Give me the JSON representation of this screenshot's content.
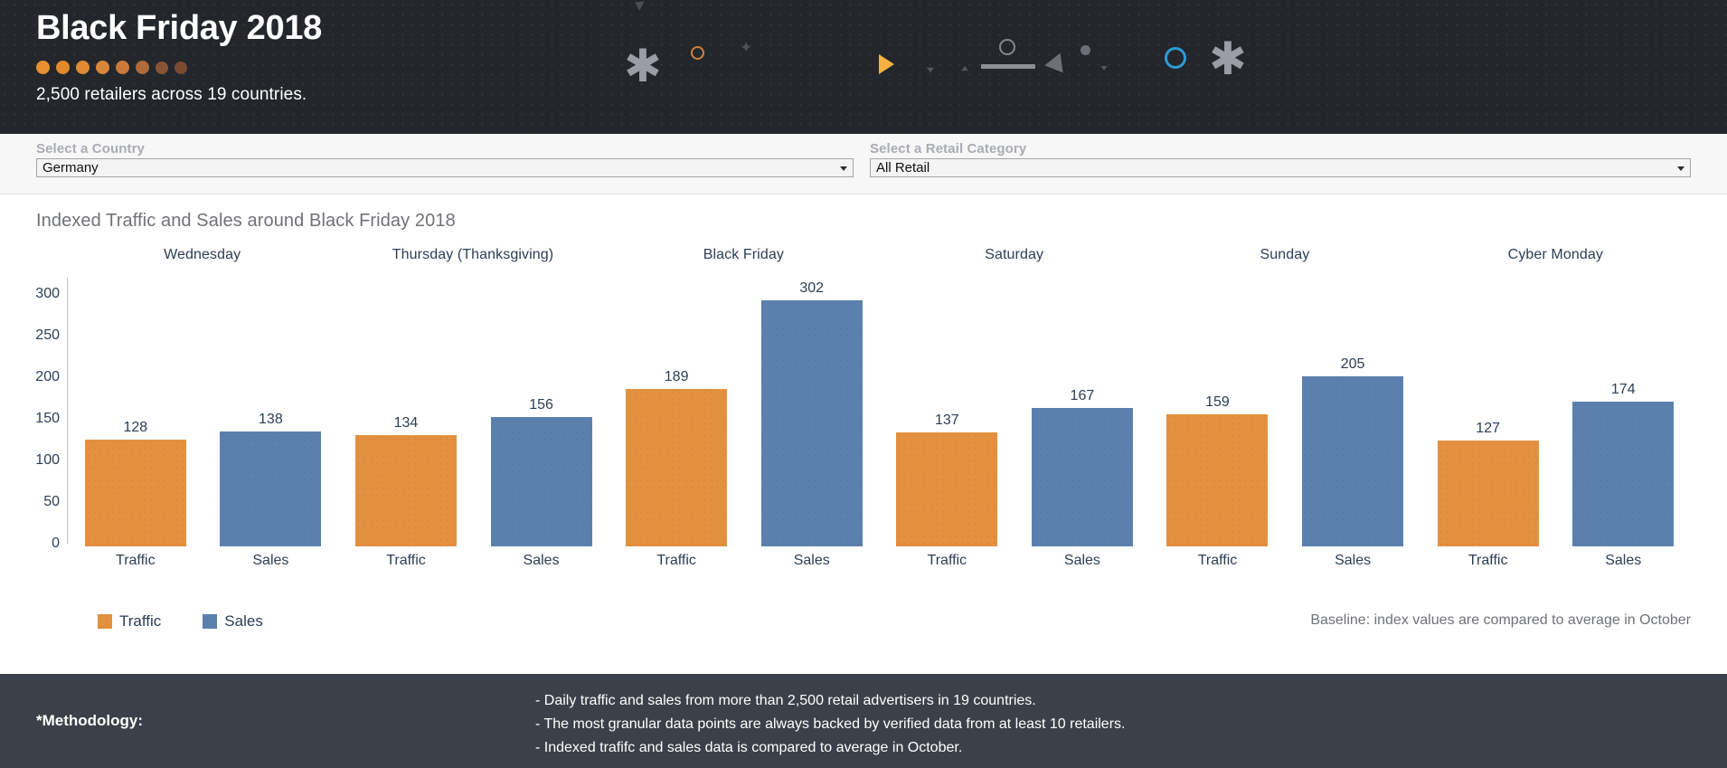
{
  "header": {
    "title": "Black Friday 2018",
    "subtitle": "2,500 retailers across 19 countries.",
    "dot_colors": [
      "#e8902f",
      "#e08a2c",
      "#dd8a33",
      "#d9853a",
      "#c9793a",
      "#b06a3c",
      "#8a5336",
      "#7c4a30"
    ],
    "accent_orange": "#e8902f",
    "accent_blue": "#2e9bd6",
    "background": "#23262b"
  },
  "filters": {
    "country": {
      "label": "Select a Country",
      "value": "Germany"
    },
    "category": {
      "label": "Select a Retail Category",
      "value": "All Retail"
    }
  },
  "chart": {
    "title": "Indexed Traffic and Sales around Black Friday 2018",
    "legend": [
      {
        "label": "Traffic",
        "color": "#e3903f"
      },
      {
        "label": "Sales",
        "color": "#5b80ae"
      }
    ],
    "baseline_note": "Baseline: index values are compared to average in October"
  },
  "chart_data": {
    "type": "bar",
    "title": "Indexed Traffic and Sales around Black Friday 2018",
    "xlabel": "",
    "ylabel": "",
    "ylim": [
      0,
      320
    ],
    "yticks": [
      300,
      250,
      200,
      150,
      100,
      50,
      0
    ],
    "grid": false,
    "legend_position": "bottom-left",
    "categories": [
      "Wednesday",
      "Thursday (Thanksgiving)",
      "Black Friday",
      "Saturday",
      "Sunday",
      "Cyber Monday"
    ],
    "series": [
      {
        "name": "Traffic",
        "color": "#e3903f",
        "values": [
          128,
          134,
          189,
          137,
          159,
          127
        ]
      },
      {
        "name": "Sales",
        "color": "#5b80ae",
        "values": [
          138,
          156,
          302,
          167,
          205,
          174
        ]
      }
    ],
    "groups": [
      {
        "day": "Wednesday",
        "bars": [
          {
            "series": "Traffic",
            "label": "Traffic",
            "value": 128
          },
          {
            "series": "Sales",
            "label": "Sales",
            "value": 138
          }
        ]
      },
      {
        "day": "Thursday (Thanksgiving)",
        "bars": [
          {
            "series": "Traffic",
            "label": "Traffic",
            "value": 134
          },
          {
            "series": "Sales",
            "label": "Sales",
            "value": 156
          }
        ]
      },
      {
        "day": "Black Friday",
        "bars": [
          {
            "series": "Traffic",
            "label": "Traffic",
            "value": 189
          },
          {
            "series": "Sales",
            "label": "Sales",
            "value": 302
          }
        ]
      },
      {
        "day": "Saturday",
        "bars": [
          {
            "series": "Traffic",
            "label": "Traffic",
            "value": 137
          },
          {
            "series": "Sales",
            "label": "Sales",
            "value": 167
          }
        ]
      },
      {
        "day": "Sunday",
        "bars": [
          {
            "series": "Traffic",
            "label": "Traffic",
            "value": 159
          },
          {
            "series": "Sales",
            "label": "Sales",
            "value": 205
          }
        ]
      },
      {
        "day": "Cyber Monday",
        "bars": [
          {
            "series": "Traffic",
            "label": "Traffic",
            "value": 127
          },
          {
            "series": "Sales",
            "label": "Sales",
            "value": 174
          }
        ]
      }
    ]
  },
  "footer": {
    "label": "*Methodology:",
    "lines": [
      "- Daily traffic and sales from more than 2,500 retail advertisers in 19 countries.",
      "- The most granular data points are always backed by verified data from at least 10 retailers.",
      "- Indexed trafifc and sales data is compared to average in October."
    ]
  }
}
